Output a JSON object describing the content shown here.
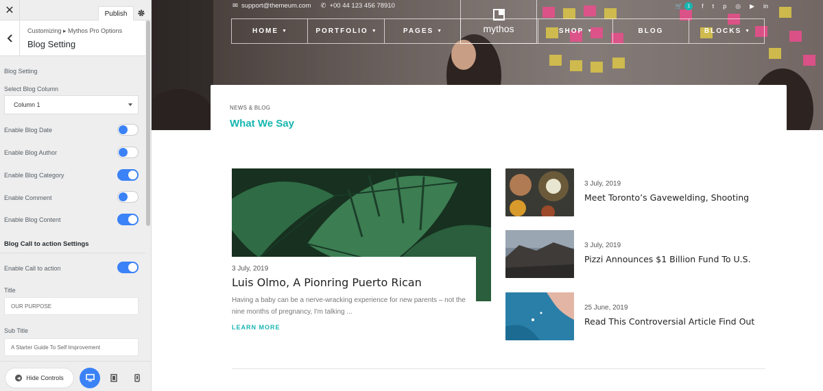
{
  "customizer": {
    "close_icon": "close-icon",
    "publish_label": "Publish",
    "gear_icon": "gear-icon",
    "breadcrumb": "Customizing ▸ Mythos Pro Options",
    "section_title": "Blog Setting",
    "group_heading": "Blog Setting",
    "select_label": "Select Blog Column",
    "select_value": "Column 1",
    "toggles": [
      {
        "label": "Enable Blog Date",
        "on": false
      },
      {
        "label": "Enable Blog Author",
        "on": false
      },
      {
        "label": "Enable Blog Category",
        "on": true
      },
      {
        "label": "Enable Comment",
        "on": false
      },
      {
        "label": "Enable Blog Content",
        "on": true
      }
    ],
    "cta_heading": "Blog Call to action Settings",
    "cta_toggle_label": "Enable Call to action",
    "cta_toggle_on": true,
    "title_label": "Title",
    "title_value": "OUR PURPOSE",
    "subtitle_label": "Sub Title",
    "subtitle_value": "A Starter Guide To Self Improvement",
    "hide_controls_label": "Hide Controls",
    "accent_color": "#3b82f6"
  },
  "site": {
    "email": "support@themeum.com",
    "phone": "+00 44 123 456 78910",
    "cart_count": "1",
    "social_icons": [
      "facebook-icon",
      "twitter-icon",
      "pinterest-icon",
      "instagram-icon",
      "youtube-icon",
      "linkedin-icon"
    ],
    "logo_text": "mythos",
    "nav": [
      {
        "label": "HOME",
        "dropdown": true
      },
      {
        "label": "PORTFOLIO",
        "dropdown": true
      },
      {
        "label": "PAGES",
        "dropdown": true
      },
      {
        "label": "SHOP",
        "dropdown": true
      },
      {
        "label": "BLOG",
        "dropdown": false
      },
      {
        "label": "BLOCKS",
        "dropdown": true
      }
    ],
    "brand_color": "#17b6b0"
  },
  "blog": {
    "eyebrow": "NEWS & BLOG",
    "heading": "What We Say",
    "featured": {
      "date": "3 July, 2019",
      "title": "Luis Olmo, A Pionring Puerto Rican",
      "excerpt": "Having a baby can be a nerve-wracking experience for new parents – not the nine months of pregnancy, I'm talking ...",
      "more": "LEARN MORE"
    },
    "posts": [
      {
        "date": "3 July, 2019",
        "title": "Meet Toronto’s Gavewelding, Shooting"
      },
      {
        "date": "3 July, 2019",
        "title": "Pizzi Announces $1 Billion Fund To U.S."
      },
      {
        "date": "25 June, 2019",
        "title": "Read This Controversial Article Find Out"
      }
    ]
  }
}
